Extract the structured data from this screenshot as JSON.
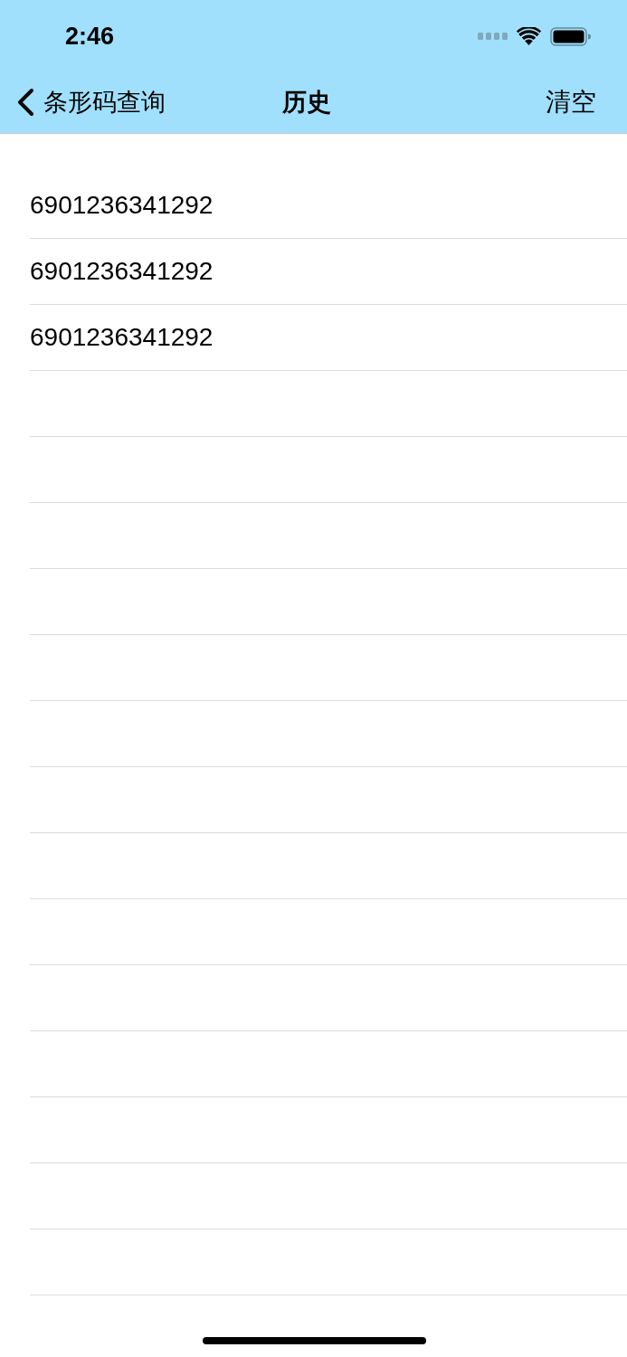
{
  "status_bar": {
    "time": "2:46"
  },
  "nav_bar": {
    "back_label": "条形码查询",
    "title": "历史",
    "action": "清空"
  },
  "history": [
    {
      "code": "6901236341292"
    },
    {
      "code": "6901236341292"
    },
    {
      "code": "6901236341292"
    }
  ]
}
